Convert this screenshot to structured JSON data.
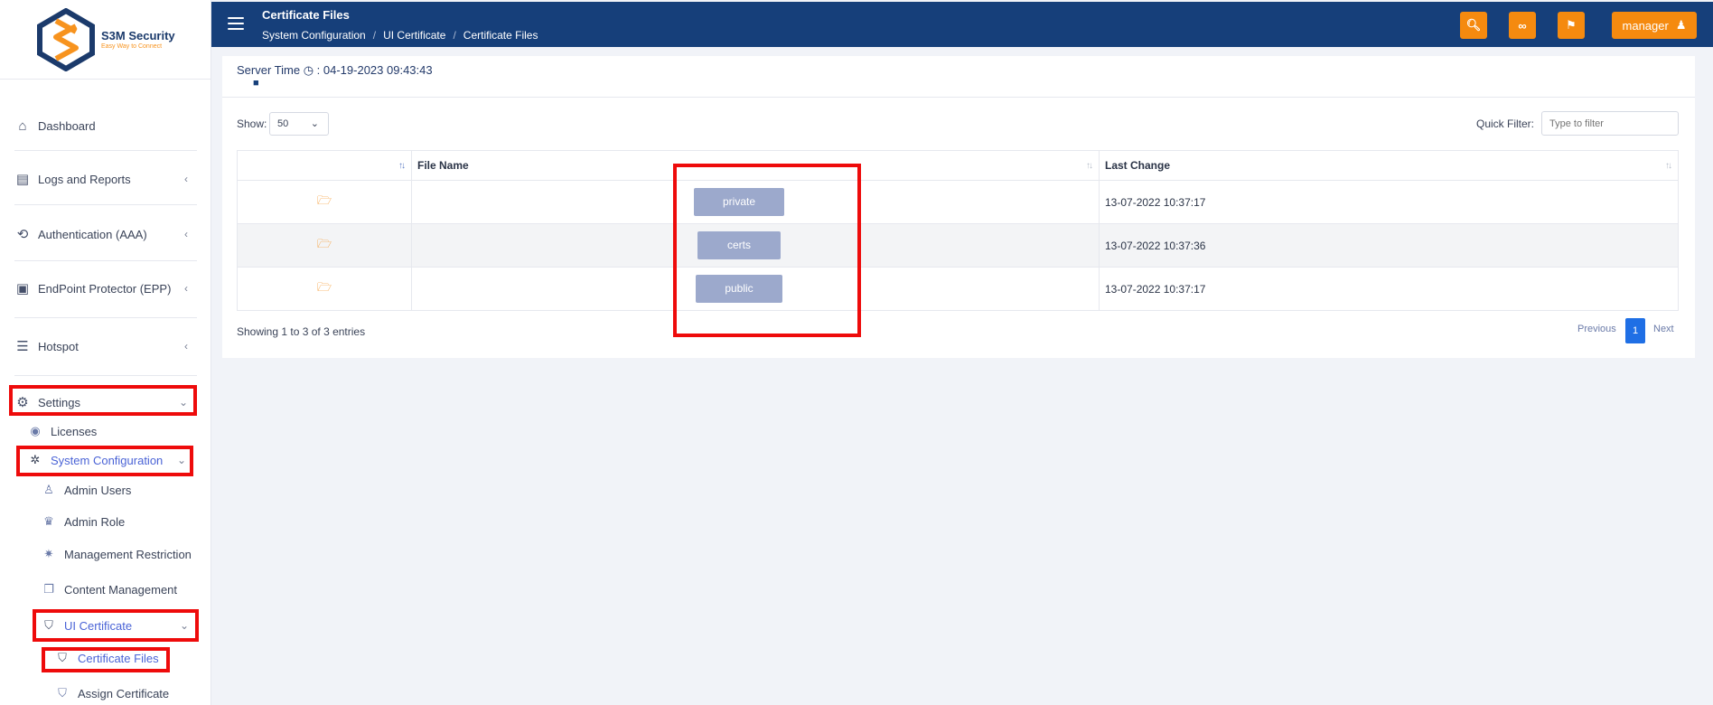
{
  "brand": {
    "name": "S3M Security",
    "tagline": "Easy Way to Connect"
  },
  "sidebar": {
    "items": [
      {
        "label": "Dashboard",
        "icon": "home-icon"
      },
      {
        "label": "Logs and Reports",
        "icon": "report-icon"
      },
      {
        "label": "Authentication (AAA)",
        "icon": "auth-icon"
      },
      {
        "label": "EndPoint Protector (EPP)",
        "icon": "calendar-check-icon"
      },
      {
        "label": "Hotspot",
        "icon": "list-icon"
      },
      {
        "label": "Settings",
        "icon": "gear-icon"
      }
    ],
    "settings_children": {
      "licenses": "Licenses",
      "system_configuration": "System Configuration",
      "admin_users": "Admin Users",
      "admin_role": "Admin Role",
      "management_restriction": "Management Restriction",
      "content_management": "Content Management",
      "ui_certificate": "UI Certificate",
      "certificate_files": "Certificate Files",
      "assign_certificate": "Assign Certificate"
    }
  },
  "header": {
    "title": "Certificate Files",
    "breadcrumb": [
      "System Configuration",
      "UI Certificate",
      "Certificate Files"
    ],
    "user": "manager"
  },
  "server_time": {
    "label": "Server Time",
    "value": ": 04-19-2023 09:43:43"
  },
  "table_controls": {
    "show_label": "Show:",
    "show_value": "50",
    "quick_filter_label": "Quick Filter:",
    "quick_filter_placeholder": "Type to filter"
  },
  "table": {
    "columns": [
      "",
      "File Name",
      "Last Change"
    ],
    "rows": [
      {
        "name": "private",
        "last_change": "13-07-2022 10:37:17"
      },
      {
        "name": "certs",
        "last_change": "13-07-2022 10:37:36"
      },
      {
        "name": "public",
        "last_change": "13-07-2022 10:37:17"
      }
    ]
  },
  "footer": {
    "showing": "Showing 1 to 3 of 3 entries",
    "previous": "Previous",
    "page": "1",
    "next": "Next"
  },
  "colors": {
    "header": "#163f7a",
    "accent": "#f58a0f",
    "highlight": "#ee0b0b"
  }
}
